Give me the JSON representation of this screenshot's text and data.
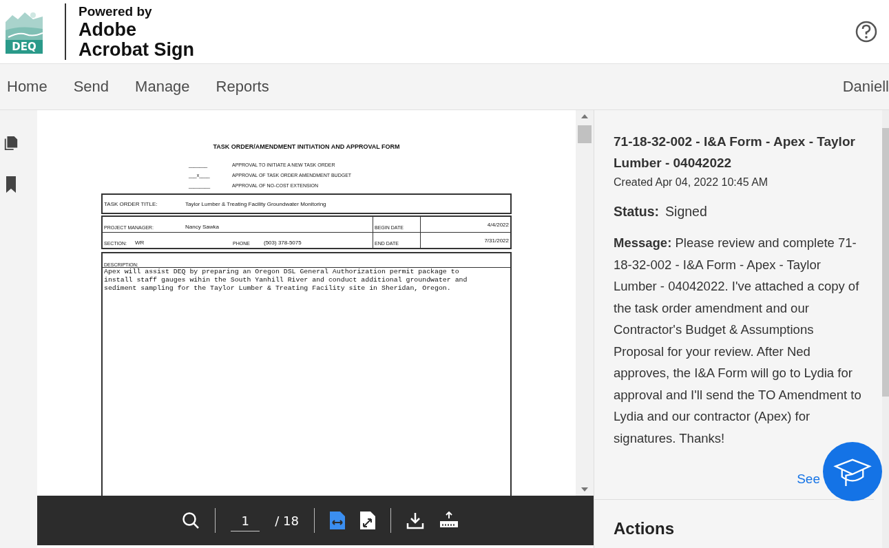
{
  "header": {
    "logo_text": "DEQ",
    "powered_by": "Powered by",
    "brand_lines": [
      "Adobe",
      "Acrobat Sign"
    ]
  },
  "nav": {
    "items": [
      {
        "label": "Home",
        "selected": false
      },
      {
        "label": "Send",
        "selected": false
      },
      {
        "label": "Manage",
        "selected": false
      },
      {
        "label": "Reports",
        "selected": false
      }
    ],
    "user": "Daniell"
  },
  "document": {
    "title": "TASK ORDER/AMENDMENT INITIATION AND APPROVAL FORM",
    "approvals": [
      {
        "blank": "_______",
        "label": "APPROVAL TO INITIATE A NEW TASK ORDER"
      },
      {
        "blank": "___x____",
        "label": "APPROVAL OF TASK ORDER AMENDMENT BUDGET"
      },
      {
        "blank": "________",
        "label": "APPROVAL OF NO-COST EXTENSION"
      }
    ],
    "task_order_title": {
      "label": "TASK ORDER TITLE:",
      "value": "Taylor Lumber & Treating Facility Groundwater Monitoring"
    },
    "project_manager": {
      "label": "PROJECT MANAGER:",
      "value": "Nancy Sawka"
    },
    "begin_date": {
      "label": "BEGIN DATE",
      "value": "4/4/2022"
    },
    "section": {
      "label": "SECTION:",
      "value": "WR"
    },
    "phone": {
      "label": "PHONE",
      "value": "(503) 378-5075"
    },
    "end_date": {
      "label": "END DATE",
      "value": "7/31/2022"
    },
    "description": {
      "label": "DESCRIPTION:",
      "lines": [
        "Apex will assist DEQ by preparing an Oregon DSL General Authorization permit package to",
        "install staff gauges wihin the South Yanhill River and conduct additional groundwater and",
        "sediment sampling for the Taylor Lumber & Treating Facility site in Sheridan, Oregon."
      ]
    }
  },
  "toolbar": {
    "page": "1",
    "total": "/ 18",
    "fit_width_selected": true,
    "fit_page_selected": false
  },
  "panel": {
    "title": "71-18-32-002 - I&A Form - Apex - Taylor Lumber - 04042022",
    "created": "Created Apr 04, 2022 10:45 AM",
    "status_label": "Status:",
    "status": "Signed",
    "message_label": "Message:",
    "message": "Please review and complete 71-18-32-002 - I&A Form - Apex - Taylor Lumber - 04042022. I've attached a copy of the task order amendment and our Contractor's Budget & Assumptions Proposal for your review. After Ned approves, the I&A Form will go to Lydia for approval and I'll send the TO Amendment to Lydia and our contractor (Apex) for signatures. Thanks!",
    "see_less": "See",
    "actions": "Actions"
  }
}
